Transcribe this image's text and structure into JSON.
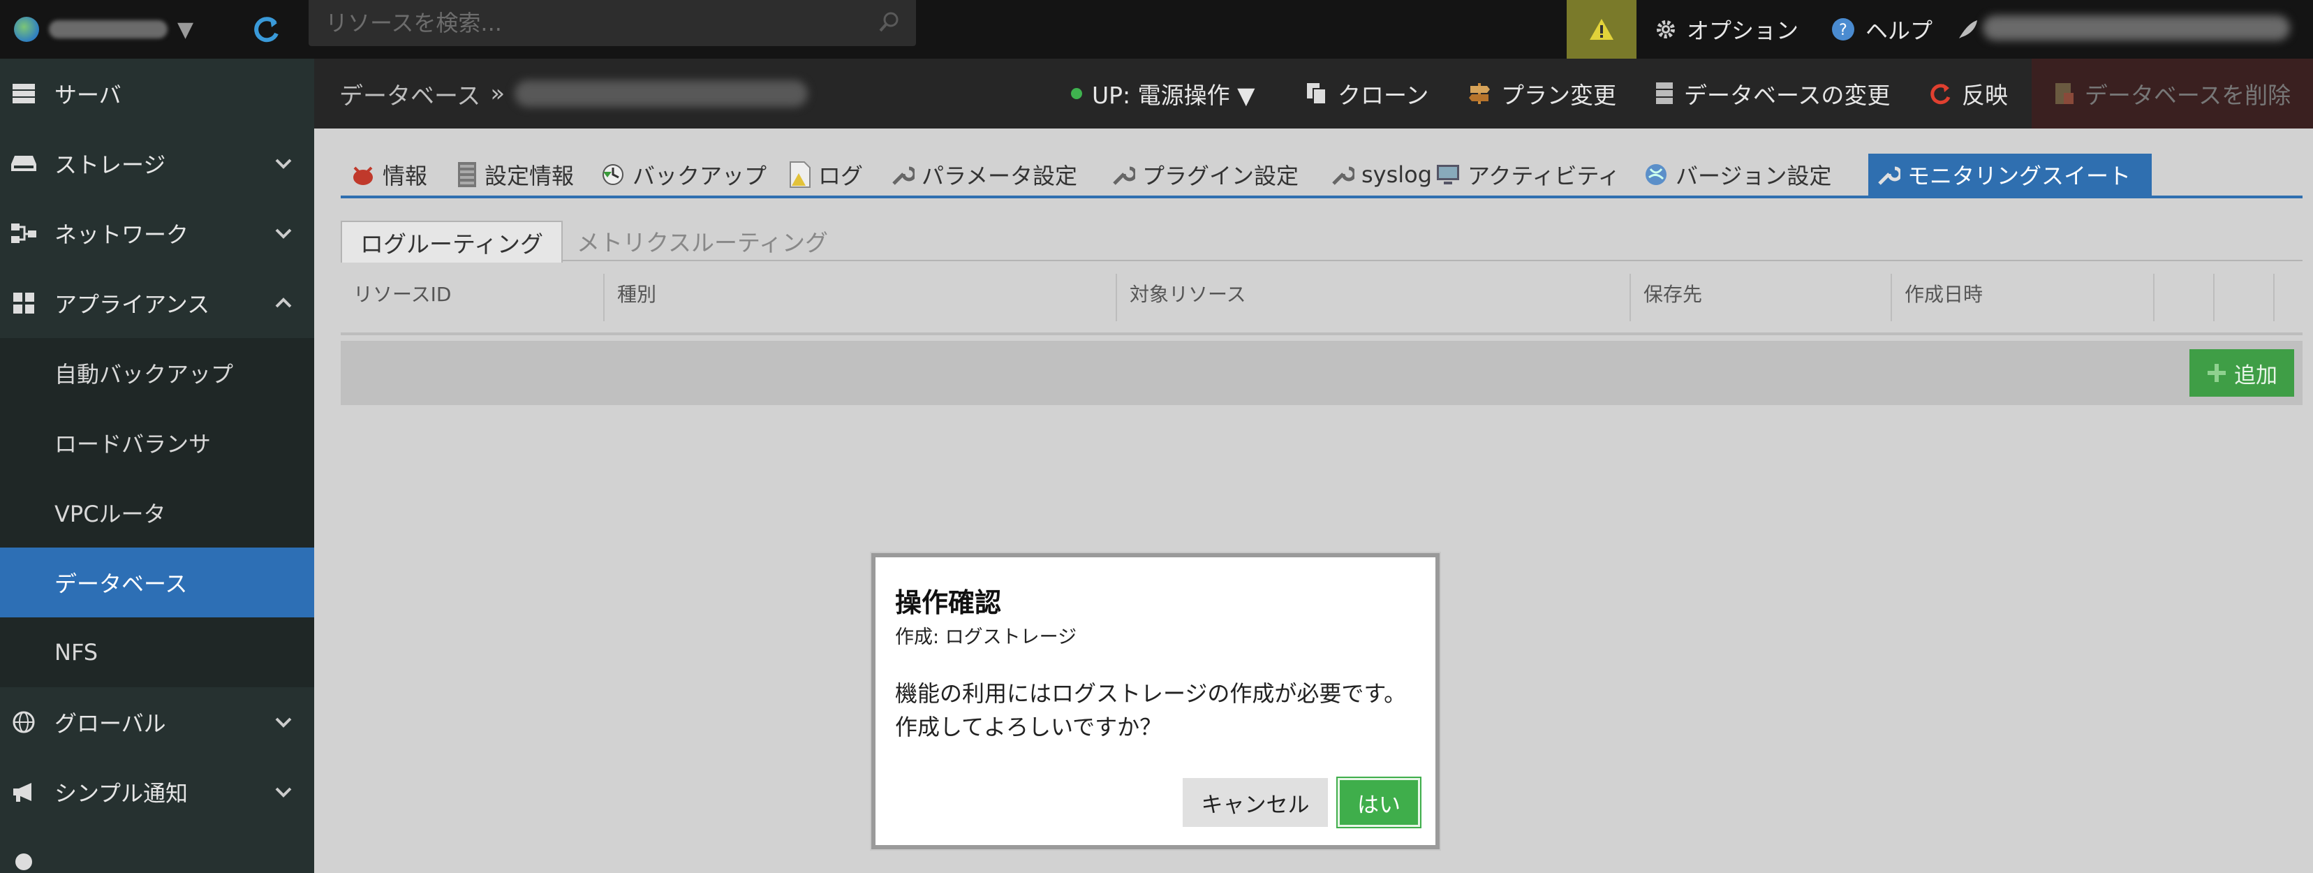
{
  "topbar": {
    "search_placeholder": "リソースを検索...",
    "options_label": "オプション",
    "help_label": "ヘルプ"
  },
  "sidebar": {
    "items": [
      {
        "label": "サーバ",
        "icon": "server-icon"
      },
      {
        "label": "ストレージ",
        "icon": "storage-icon"
      },
      {
        "label": "ネットワーク",
        "icon": "network-icon"
      },
      {
        "label": "アプライアンス",
        "icon": "appliance-icon"
      },
      {
        "label": "グローバル",
        "icon": "globe-icon"
      },
      {
        "label": "シンプル通知",
        "icon": "megaphone-icon"
      }
    ],
    "subitems": [
      {
        "label": "自動バックアップ"
      },
      {
        "label": "ロードバランサ"
      },
      {
        "label": "VPCルータ"
      },
      {
        "label": "データベース",
        "active": true
      },
      {
        "label": "NFS"
      }
    ]
  },
  "header": {
    "breadcrumb": "データベース",
    "breadcrumb_sep": "»",
    "power": "UP: 電源操作 ▼",
    "clone": "クローン",
    "plan": "プラン変更",
    "change_db": "データベースの変更",
    "apply": "反映",
    "delete": "データベースを削除"
  },
  "tabs": [
    {
      "label": "情報"
    },
    {
      "label": "設定情報"
    },
    {
      "label": "バックアップ"
    },
    {
      "label": "ログ"
    },
    {
      "label": "パラメータ設定"
    },
    {
      "label": "プラグイン設定"
    },
    {
      "label": "syslog"
    },
    {
      "label": "アクティビティ"
    },
    {
      "label": "バージョン設定"
    },
    {
      "label": "モニタリングスイート",
      "active": true
    }
  ],
  "subtabs": [
    {
      "label": "ログルーティング",
      "active": true
    },
    {
      "label": "メトリクスルーティング"
    }
  ],
  "table": {
    "columns": [
      "リソースID",
      "種別",
      "対象リソース",
      "保存先",
      "作成日時"
    ]
  },
  "add_button": "追加",
  "dialog": {
    "title": "操作確認",
    "subtitle": "作成: ログストレージ",
    "message_line1": "機能の利用にはログストレージの作成が必要です。",
    "message_line2": "作成してよろしいですか？",
    "cancel": "キャンセル",
    "ok": "はい"
  },
  "colors": {
    "accent": "#2f6fb0",
    "success": "#3fae4b",
    "sidebar": "#263130",
    "topbar": "#141414"
  }
}
